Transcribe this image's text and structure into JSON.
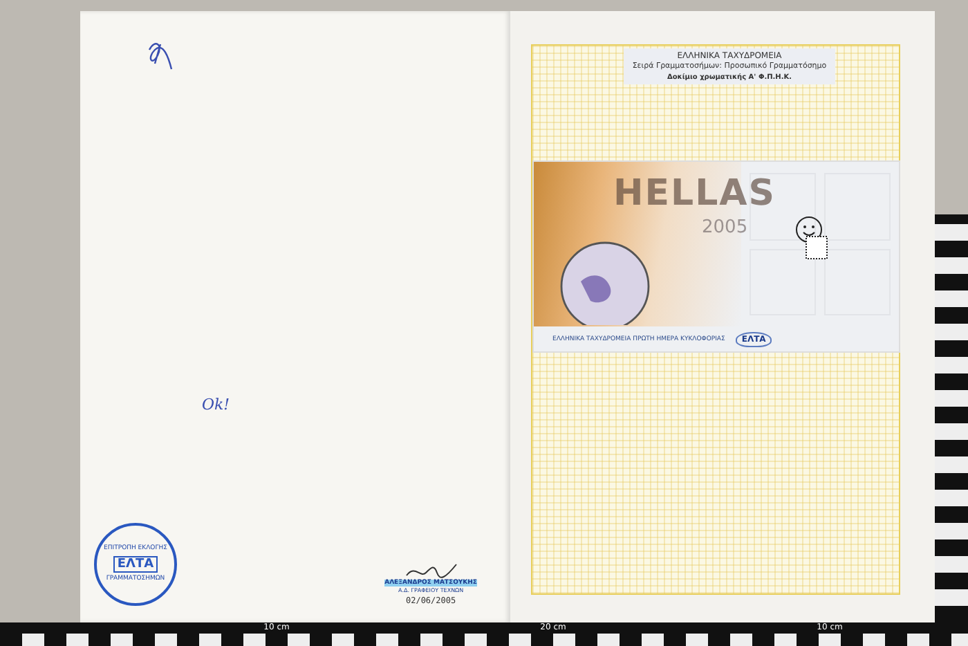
{
  "left_page": {
    "note": "Ok!",
    "seal": {
      "ring_top": "ΕΠΙΤΡΟΠΗ ΕΚΛΟΓΗΣ",
      "ring_bottom": "ΓΡΑΜΜΑΤΟΣΗΜΩΝ",
      "center": "ΕΛΤΑ"
    },
    "signature": {
      "name": "ΑΛΕΞΑΝΔΡΟΣ ΜΑΤΣΟΥΚΗΣ",
      "title": "Α.Δ. ΓΡΑΦΕΙΟΥ ΤΕΧΝΩΝ",
      "date": "02/06/2005"
    }
  },
  "right_page": {
    "label": [
      "ΕΛΛΗΝΙΚΑ ΤΑΧΥΔΡΟΜΕΙΑ",
      "Σειρά Γραμματοσήμων: Προσωπικό Γραμματόσημο",
      "Δοκίμιο χρωματικής Α' Φ.Π.Η.Κ."
    ],
    "cover": {
      "title": "HELLAS",
      "year": "2005",
      "footer": "ΕΛΛΗΝΙΚΑ ΤΑΧΥΔΡΟΜΕΙΑ ΠΡΩΤΗ ΗΜΕΡΑ ΚΥΚΛΟΦΟΡΙΑΣ",
      "logo": "ΕΛΤΑ"
    }
  },
  "ruler": {
    "labels": [
      "10 cm",
      "20 cm",
      "10 cm"
    ]
  }
}
